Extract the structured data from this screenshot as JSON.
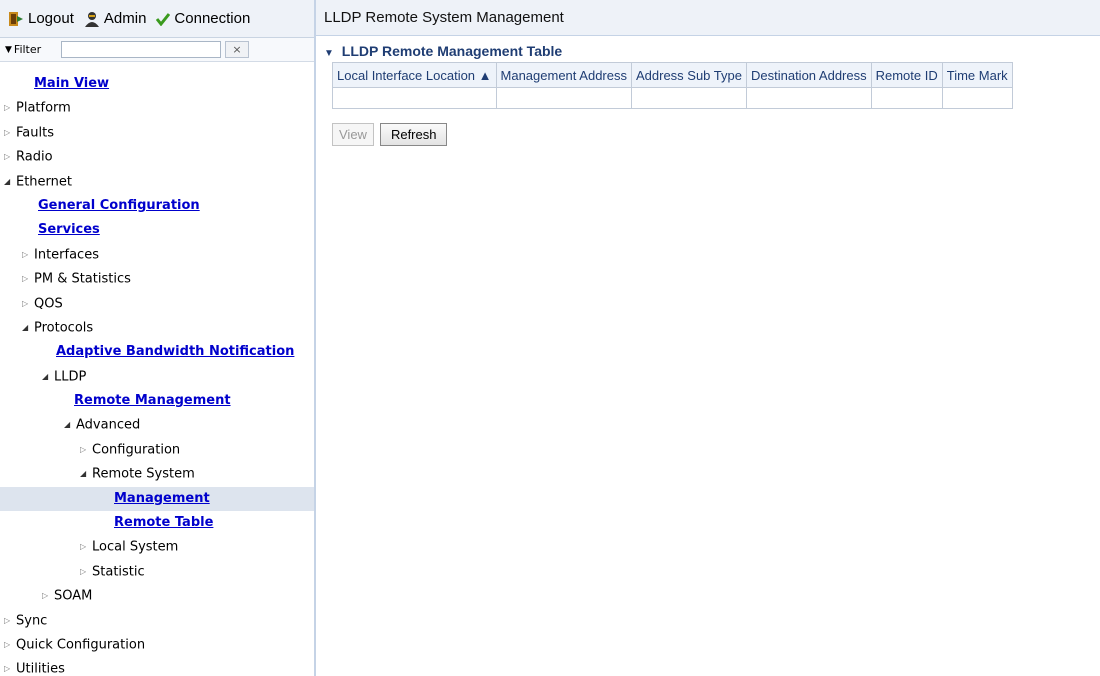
{
  "topbar": {
    "logout": "Logout",
    "admin": "Admin",
    "connection": "Connection"
  },
  "filter": {
    "label": "Filter",
    "value": "",
    "clear": "×"
  },
  "tree": [
    {
      "label": "Main View",
      "indent": 0,
      "type": "link"
    },
    {
      "label": "Platform",
      "indent": 0,
      "type": "collapsed"
    },
    {
      "label": "Faults",
      "indent": 0,
      "type": "collapsed"
    },
    {
      "label": "Radio",
      "indent": 0,
      "type": "collapsed"
    },
    {
      "label": "Ethernet",
      "indent": 0,
      "type": "expanded"
    },
    {
      "label": "General Configuration",
      "indent": 1,
      "type": "link"
    },
    {
      "label": "Services",
      "indent": 1,
      "type": "link"
    },
    {
      "label": "Interfaces",
      "indent": 1,
      "type": "collapsed"
    },
    {
      "label": "PM & Statistics",
      "indent": 1,
      "type": "collapsed"
    },
    {
      "label": "QOS",
      "indent": 1,
      "type": "collapsed"
    },
    {
      "label": "Protocols",
      "indent": 1,
      "type": "expanded"
    },
    {
      "label": "Adaptive Bandwidth Notification",
      "indent": 2,
      "type": "link"
    },
    {
      "label": "LLDP",
      "indent": 2,
      "type": "expanded"
    },
    {
      "label": "Remote Management",
      "indent": 3,
      "type": "link"
    },
    {
      "label": "Advanced",
      "indent": 3,
      "type": "expanded"
    },
    {
      "label": "Configuration",
      "indent": 4,
      "type": "collapsed"
    },
    {
      "label": "Remote System",
      "indent": 4,
      "type": "expanded"
    },
    {
      "label": "Management",
      "indent": 5,
      "type": "link",
      "selected": true
    },
    {
      "label": "Remote Table",
      "indent": 5,
      "type": "link"
    },
    {
      "label": "Local System",
      "indent": 4,
      "type": "collapsed"
    },
    {
      "label": "Statistic",
      "indent": 4,
      "type": "collapsed"
    },
    {
      "label": "SOAM",
      "indent": 2,
      "type": "collapsed"
    },
    {
      "label": "Sync",
      "indent": 0,
      "type": "collapsed"
    },
    {
      "label": "Quick Configuration",
      "indent": 0,
      "type": "collapsed"
    },
    {
      "label": "Utilities",
      "indent": 0,
      "type": "collapsed"
    }
  ],
  "content": {
    "header": "LLDP Remote System Management",
    "table_title": "LLDP Remote Management Table",
    "columns": [
      "Local Interface Location ▲",
      "Management Address",
      "Address Sub Type",
      "Destination Address",
      "Remote ID",
      "Time Mark"
    ],
    "buttons": {
      "view": "View",
      "refresh": "Refresh"
    }
  },
  "colors": {
    "header_bg": "#eef2f8",
    "link": "#0000cc",
    "title": "#1f3d73",
    "selected_row": "#dde4ee"
  }
}
